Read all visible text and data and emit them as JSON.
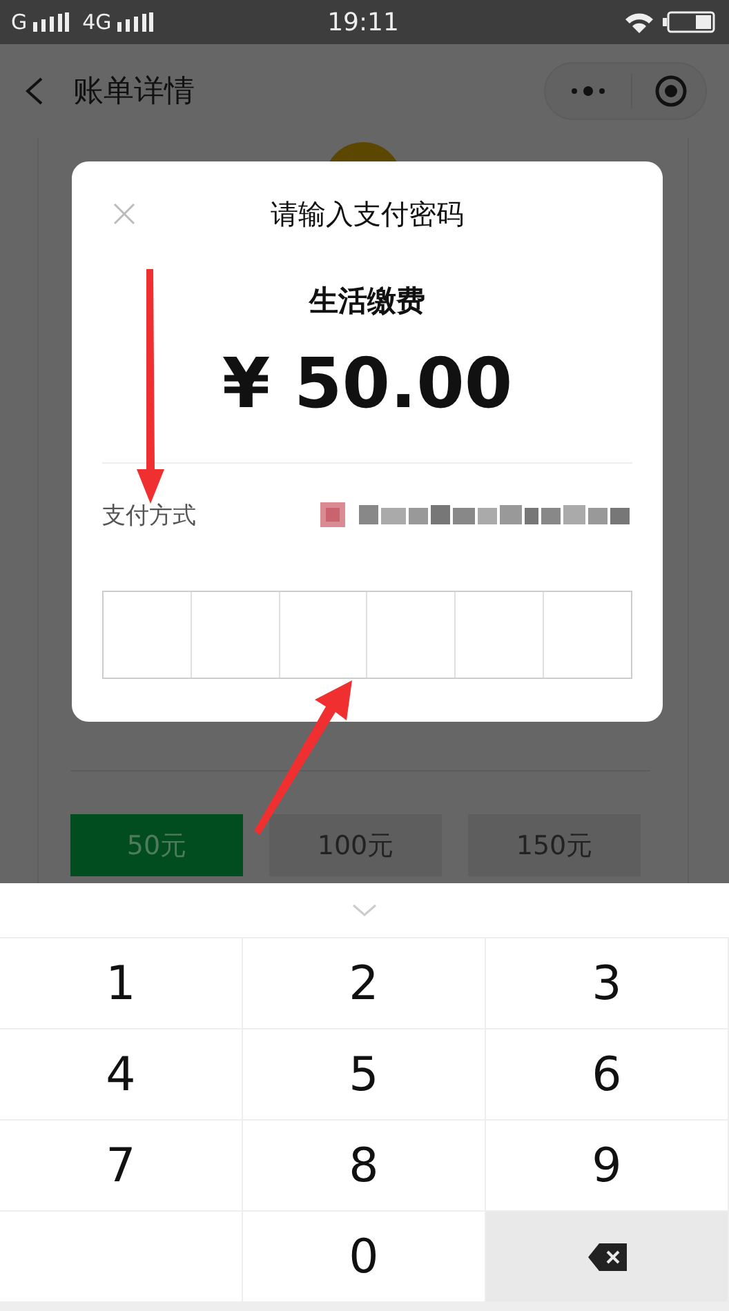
{
  "status_bar": {
    "carrier_1": "G",
    "carrier_2": "4G",
    "time": "19:11"
  },
  "header": {
    "title": "账单详情"
  },
  "page": {
    "options": [
      {
        "label": "50元",
        "selected": true
      },
      {
        "label": "100元",
        "selected": false
      },
      {
        "label": "150元",
        "selected": false
      }
    ]
  },
  "dialog": {
    "title": "请输入支付密码",
    "merchant": "生活缴费",
    "amount": "¥ 50.00",
    "payment_method_label": "支付方式",
    "password_boxes": [
      {
        "filled": false
      },
      {
        "filled": false
      },
      {
        "filled": false
      },
      {
        "filled": false
      },
      {
        "filled": false
      },
      {
        "filled": false
      }
    ]
  },
  "keypad": {
    "keys": [
      {
        "kind": "digit",
        "label": "1"
      },
      {
        "kind": "digit",
        "label": "2"
      },
      {
        "kind": "digit",
        "label": "3"
      },
      {
        "kind": "digit",
        "label": "4"
      },
      {
        "kind": "digit",
        "label": "5"
      },
      {
        "kind": "digit",
        "label": "6"
      },
      {
        "kind": "digit",
        "label": "7"
      },
      {
        "kind": "digit",
        "label": "8"
      },
      {
        "kind": "digit",
        "label": "9"
      },
      {
        "kind": "blank"
      },
      {
        "kind": "digit",
        "label": "0"
      },
      {
        "kind": "backspace"
      }
    ]
  }
}
